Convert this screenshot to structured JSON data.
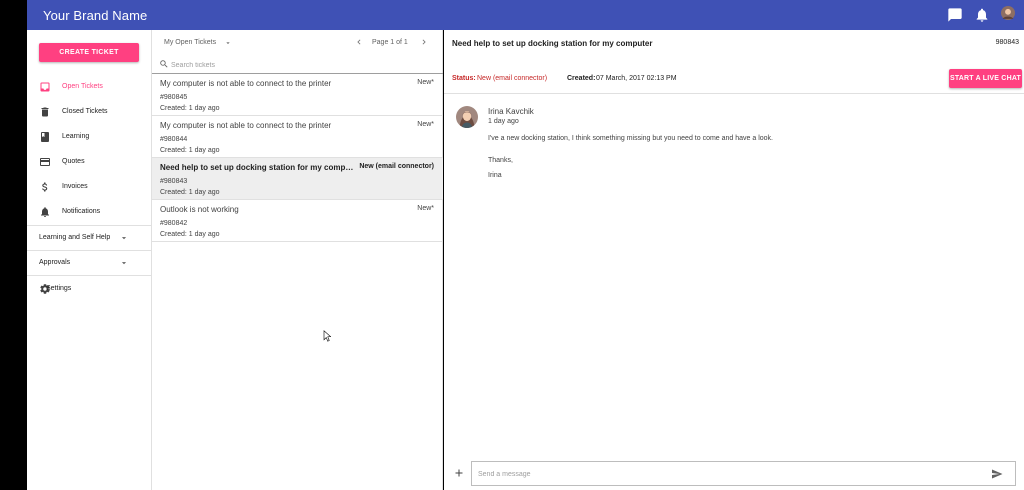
{
  "app": {
    "brand": "Your Brand Name",
    "brand_color": "#3f51b5",
    "accent": "#ff4081"
  },
  "appbar": {
    "icons": [
      "chat-icon",
      "bell-icon",
      "avatar"
    ]
  },
  "sidebar": {
    "create_label": "CREATE TICKET",
    "items": [
      {
        "label": "Open Tickets",
        "icon": "inbox-icon",
        "active": true
      },
      {
        "label": "Closed Tickets",
        "icon": "trash-icon",
        "active": false
      },
      {
        "label": "Learning",
        "icon": "book-icon",
        "active": false
      },
      {
        "label": "Quotes",
        "icon": "card-icon",
        "active": false
      },
      {
        "label": "Invoices",
        "icon": "dollar-icon",
        "active": false
      },
      {
        "label": "Notifications",
        "icon": "bell-icon",
        "active": false
      }
    ],
    "sections": [
      {
        "label": "Learning and Self Help"
      },
      {
        "label": "Approvals"
      }
    ],
    "settings_label": "Settings"
  },
  "list": {
    "filter": "My Open Tickets",
    "pager": "Page 1 of 1",
    "search_placeholder": "Search tickets",
    "tickets": [
      {
        "title": "My computer is not able to connect to the printer",
        "status": "New*",
        "number": "#980845",
        "created": "Created: 1 day ago"
      },
      {
        "title": "My computer is not able to connect to the printer",
        "status": "New*",
        "number": "#980844",
        "created": "Created: 1 day ago"
      },
      {
        "title": "Need help to set up docking station for my computer",
        "status": "New (email connector)",
        "number": "#980843",
        "created": "Created: 1 day ago"
      },
      {
        "title": "Outlook is not working",
        "status": "New*",
        "number": "#980842",
        "created": "Created: 1 day ago"
      }
    ]
  },
  "detail": {
    "title": "Need help to set up docking station for my computer",
    "number": "980843",
    "status_label": "Status:",
    "status": "New (email connector)",
    "created_label": "Created:",
    "created": "07 March, 2017 02:13 PM",
    "live_chat_label": "START A LIVE CHAT",
    "message": {
      "author": "Irina Kavchik",
      "time": "1 day ago",
      "lines": [
        "I've a new docking station, I think something missing but you need to come and have a look.",
        "Thanks,",
        "Irina"
      ]
    },
    "composer_placeholder": "Send a message"
  }
}
